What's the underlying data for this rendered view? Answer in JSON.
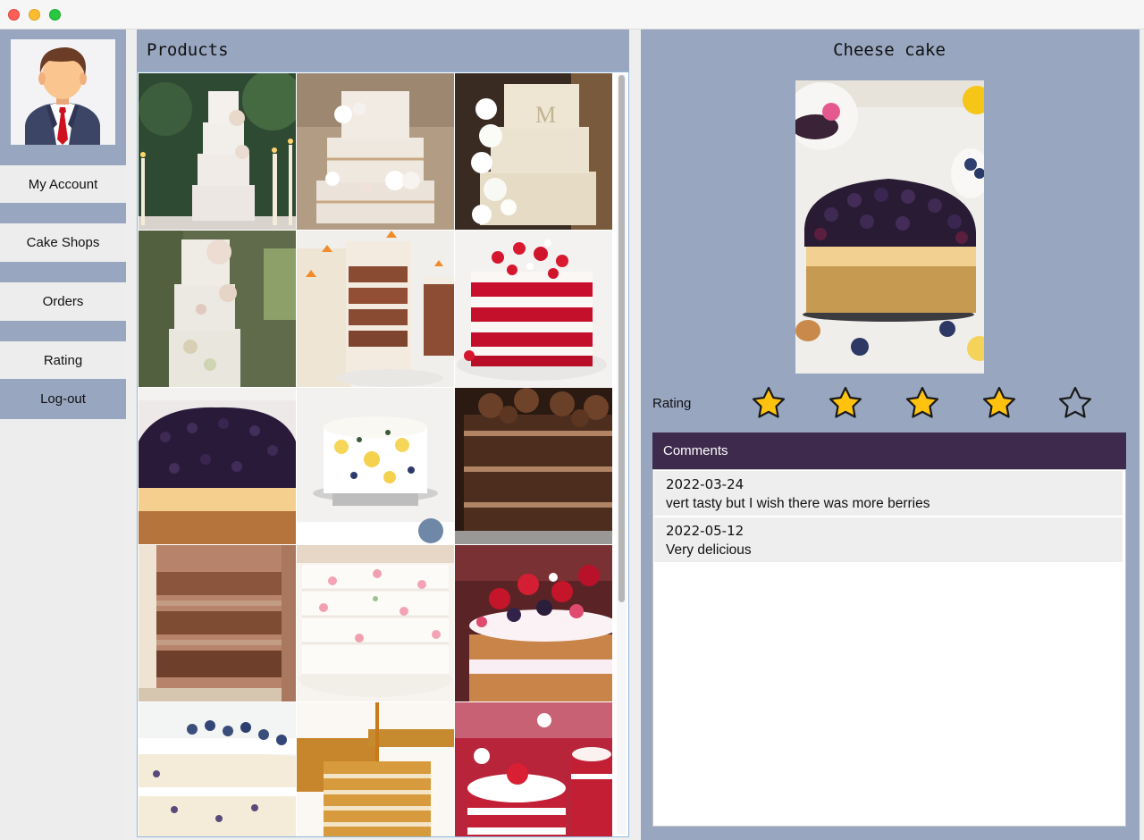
{
  "window": {
    "controls": [
      "close",
      "minimize",
      "maximize"
    ]
  },
  "sidebar": {
    "avatar": "businessman-avatar-icon",
    "items": [
      {
        "label": "My Account"
      },
      {
        "label": "Cake Shops"
      },
      {
        "label": "Orders"
      },
      {
        "label": "Rating"
      },
      {
        "label": "Log-out"
      }
    ]
  },
  "products": {
    "title": "Products",
    "items": [
      {
        "image": "white floral wedding cake with candles"
      },
      {
        "image": "naked three tier cake with white roses"
      },
      {
        "image": "ivory wedding cake with monogram M"
      },
      {
        "image": "tall wedding cake with ruffle flowers"
      },
      {
        "image": "carrot cake slice"
      },
      {
        "image": "red velvet cake with strawberries"
      },
      {
        "image": "blueberry cheese cake"
      },
      {
        "image": "lemon blueberry cake"
      },
      {
        "image": "chocolate layer cake"
      },
      {
        "image": "caramel layer cake slice"
      },
      {
        "image": "white cake with pink flowers"
      },
      {
        "image": "berry victoria sponge cake"
      },
      {
        "image": "blueberry cake slice"
      },
      {
        "image": "honey layer cake"
      },
      {
        "image": "strawberry mini cakes"
      }
    ]
  },
  "details": {
    "title": "Cheese cake",
    "image": "blueberry cheese cake",
    "rating_label": "Rating",
    "rating": 4,
    "rating_max": 5,
    "comments_title": "Comments",
    "comments": [
      {
        "date": "2022-03-24",
        "text": "vert tasty but I wish there was more berries"
      },
      {
        "date": "2022-05-12",
        "text": "Very delicious"
      }
    ]
  },
  "colors": {
    "panel_accent": "#98a6c0",
    "comments_header": "#3e2a4d",
    "star_fill": "#ffc20e"
  }
}
